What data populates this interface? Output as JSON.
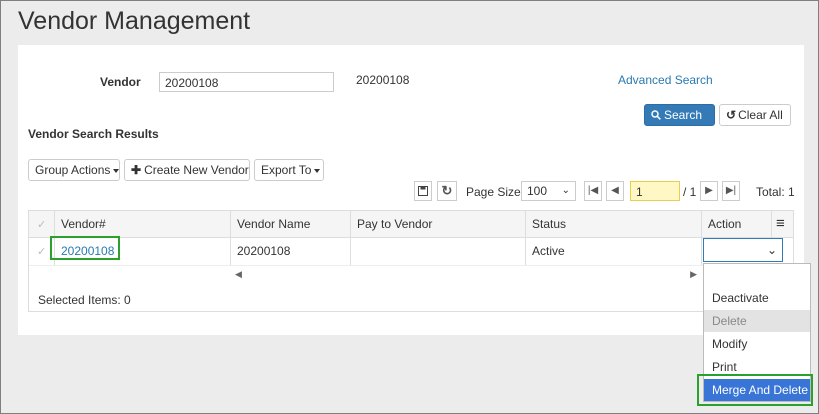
{
  "page": {
    "title": "Vendor Management"
  },
  "search": {
    "vendor_label": "Vendor",
    "vendor_value": "20200108",
    "vendor_echo": "20200108",
    "advanced_search": "Advanced Search",
    "search_button": "Search",
    "clear_all_button": "Clear All"
  },
  "results": {
    "title": "Vendor Search Results",
    "group_actions": "Group Actions",
    "create_new_vendor": "Create New Vendor",
    "export_to": "Export To",
    "page_size_label": "Page Size:",
    "page_size_value": "100",
    "page_number": "1",
    "page_total": "/ 1",
    "total": "Total: 1",
    "columns": [
      "Vendor#",
      "Vendor Name",
      "Pay to Vendor",
      "Status",
      "Action"
    ],
    "rows": [
      {
        "vendor_no": "20200108",
        "vendor_name": "20200108",
        "pay_to_vendor": "",
        "status": "Active"
      }
    ],
    "selected_items": "Selected Items: 0"
  },
  "action_dropdown": {
    "options": [
      "Deactivate",
      "Delete",
      "Modify",
      "Print",
      "Merge And Delete"
    ],
    "disabled_option": "Delete",
    "selected_option": "Merge And Delete"
  },
  "colors": {
    "primary": "#337ab7",
    "highlight_box": "#2ca02c",
    "link": "#2a7ab0"
  },
  "icons": [
    "search-icon",
    "refresh-icon",
    "plus-icon",
    "save-icon",
    "first-page-icon",
    "prev-page-icon",
    "next-page-icon",
    "last-page-icon",
    "menu-icon",
    "check-icon",
    "chevron-down-icon"
  ]
}
